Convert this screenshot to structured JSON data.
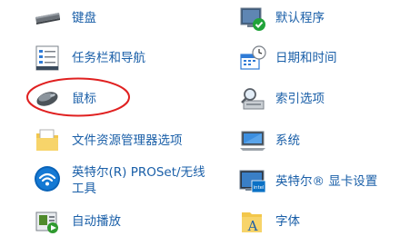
{
  "left_column": [
    {
      "label": "键盘",
      "icon": "keyboard-icon"
    },
    {
      "label": "任务栏和导航",
      "icon": "taskbar-icon"
    },
    {
      "label": "鼠标",
      "icon": "mouse-icon"
    },
    {
      "label": "文件资源管理器选项",
      "icon": "folder-options-icon"
    },
    {
      "label": "英特尔(R) PROSet/无线工具",
      "icon": "wifi-icon"
    },
    {
      "label": "自动播放",
      "icon": "autoplay-icon"
    }
  ],
  "right_column": [
    {
      "label": "默认程序",
      "icon": "default-programs-icon"
    },
    {
      "label": "日期和时间",
      "icon": "date-time-icon"
    },
    {
      "label": "索引选项",
      "icon": "indexing-options-icon"
    },
    {
      "label": "系统",
      "icon": "system-icon"
    },
    {
      "label": "英特尔® 显卡设置",
      "icon": "intel-graphics-icon"
    },
    {
      "label": "字体",
      "icon": "fonts-icon"
    }
  ],
  "colors": {
    "link": "#1a5fa8",
    "highlight_circle": "#e02020"
  }
}
